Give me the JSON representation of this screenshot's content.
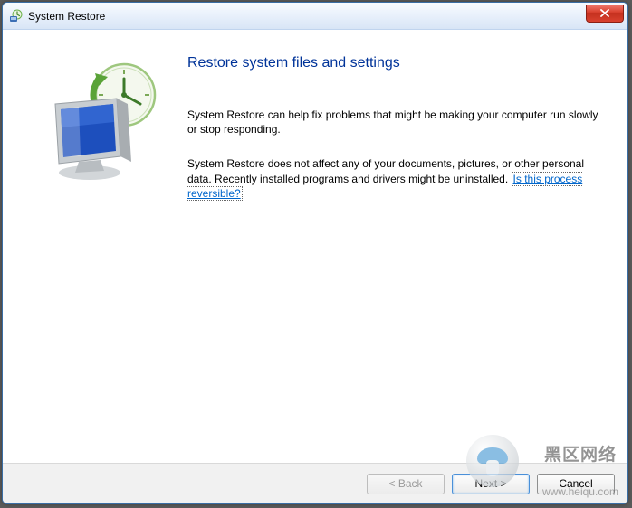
{
  "window": {
    "title": "System Restore"
  },
  "content": {
    "heading": "Restore system files and settings",
    "para1": "System Restore can help fix problems that might be making your computer run slowly or stop responding.",
    "para2_prefix": "System Restore does not affect any of your documents, pictures, or other personal data. Recently installed programs and drivers might be uninstalled. ",
    "link_text": "Is this process reversible?"
  },
  "footer": {
    "back_label": "< Back",
    "next_label": "Next >",
    "cancel_label": "Cancel"
  },
  "watermark": {
    "main_text": "黑区网络",
    "url": "www.heiqu.com"
  }
}
